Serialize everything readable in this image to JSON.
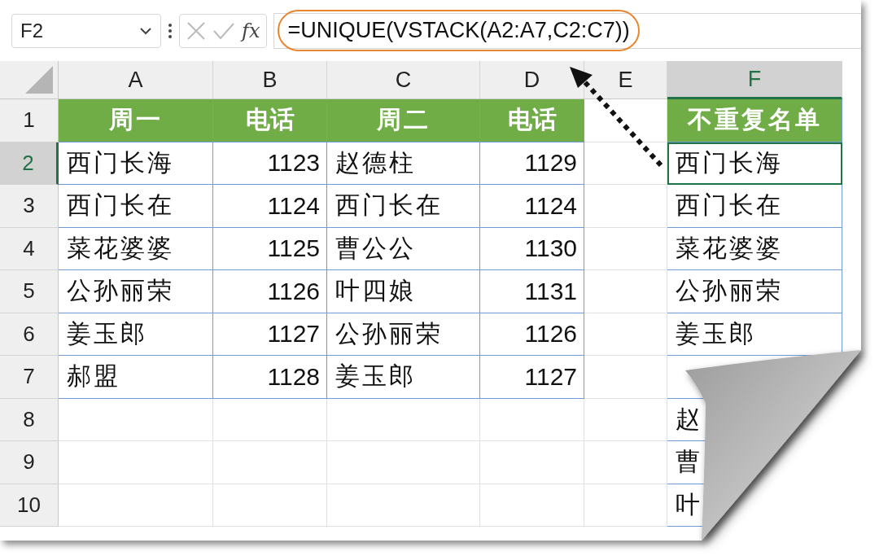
{
  "name_box": {
    "value": "F2"
  },
  "function_label": "fx",
  "formula": "=UNIQUE(VSTACK(A2:A7,C2:C7))",
  "columns": [
    {
      "label": "A",
      "selected": false
    },
    {
      "label": "B",
      "selected": false
    },
    {
      "label": "C",
      "selected": false
    },
    {
      "label": "D",
      "selected": false
    },
    {
      "label": "E",
      "selected": false
    },
    {
      "label": "F",
      "selected": true
    }
  ],
  "rows": [
    {
      "label": "1",
      "selected": false,
      "kind": "header",
      "cells": [
        "周一",
        "电话",
        "周二",
        "电话",
        "",
        "不重复名单"
      ]
    },
    {
      "label": "2",
      "selected": true,
      "kind": "data",
      "cells": [
        "西门长海",
        "1123",
        "赵德柱",
        "1129",
        "",
        "西门长海"
      ]
    },
    {
      "label": "3",
      "selected": false,
      "kind": "data",
      "cells": [
        "西门长在",
        "1124",
        "西门长在",
        "1124",
        "",
        "西门长在"
      ]
    },
    {
      "label": "4",
      "selected": false,
      "kind": "data",
      "cells": [
        "菜花婆婆",
        "1125",
        "曹公公",
        "1130",
        "",
        "菜花婆婆"
      ]
    },
    {
      "label": "5",
      "selected": false,
      "kind": "data",
      "cells": [
        "公孙丽荣",
        "1126",
        "叶四娘",
        "1131",
        "",
        "公孙丽荣"
      ]
    },
    {
      "label": "6",
      "selected": false,
      "kind": "data",
      "cells": [
        "姜玉郎",
        "1127",
        "公孙丽荣",
        "1126",
        "",
        "姜玉郎"
      ]
    },
    {
      "label": "7",
      "selected": false,
      "kind": "data",
      "cells": [
        "郝盟",
        "1128",
        "姜玉郎",
        "1127",
        "",
        ""
      ]
    },
    {
      "label": "8",
      "selected": false,
      "kind": "empty",
      "cells": [
        "",
        "",
        "",
        "",
        "",
        "赵"
      ]
    },
    {
      "label": "9",
      "selected": false,
      "kind": "empty",
      "cells": [
        "",
        "",
        "",
        "",
        "",
        "曹"
      ]
    },
    {
      "label": "10",
      "selected": false,
      "kind": "empty",
      "cells": [
        "",
        "",
        "",
        "",
        "",
        "叶"
      ]
    }
  ]
}
